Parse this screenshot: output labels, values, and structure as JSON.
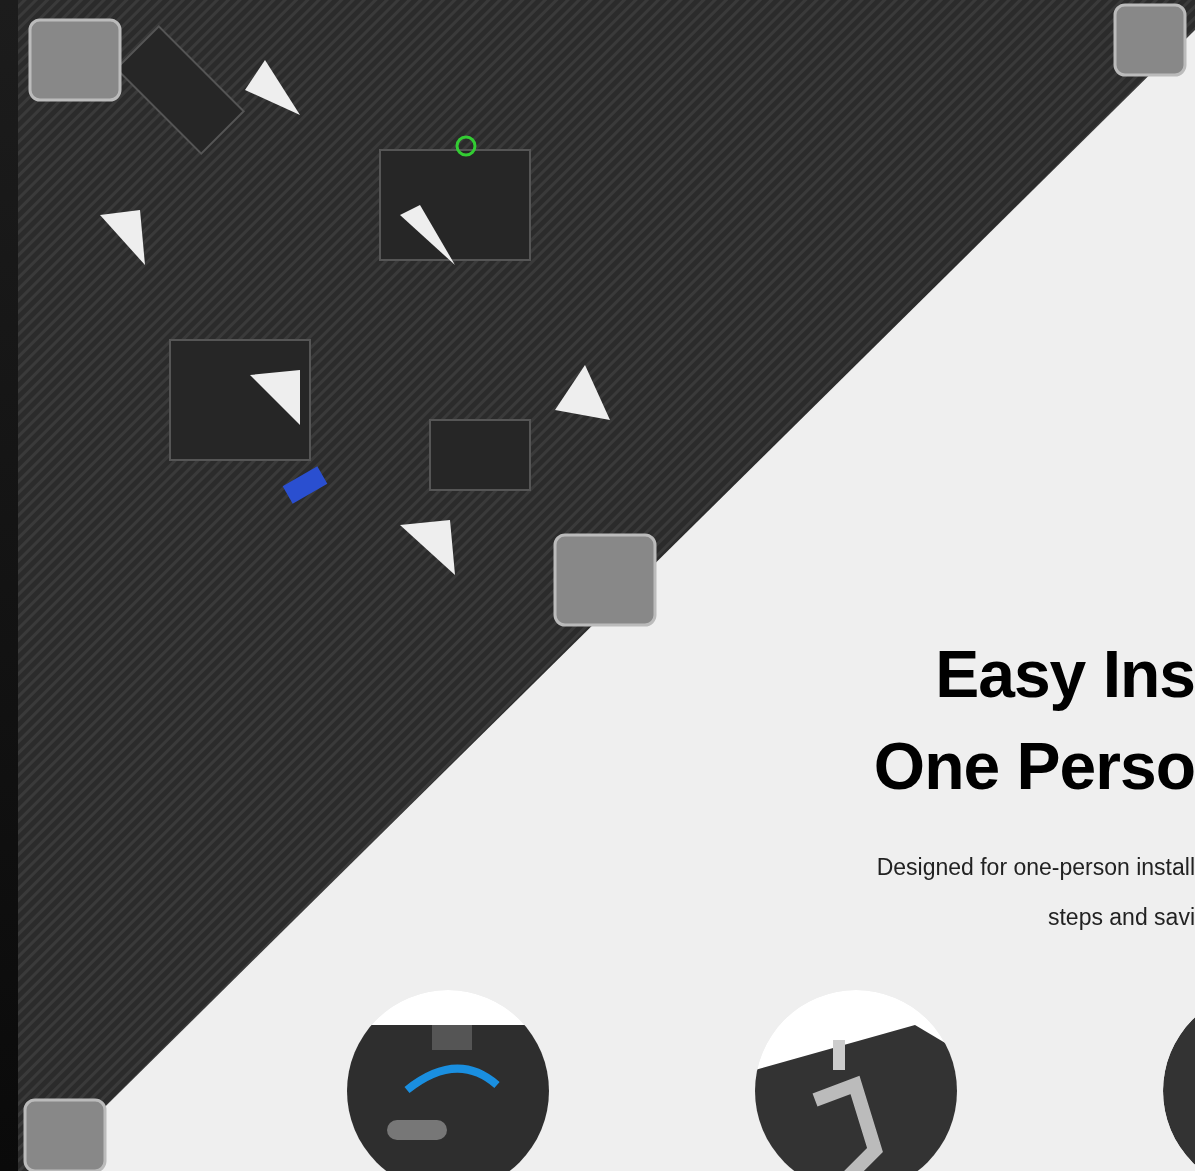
{
  "heading": {
    "lines": [
      "Easy Ins",
      "One Perso"
    ]
  },
  "description": {
    "lines": [
      "Designed for one-person install",
      "steps and savi"
    ]
  }
}
